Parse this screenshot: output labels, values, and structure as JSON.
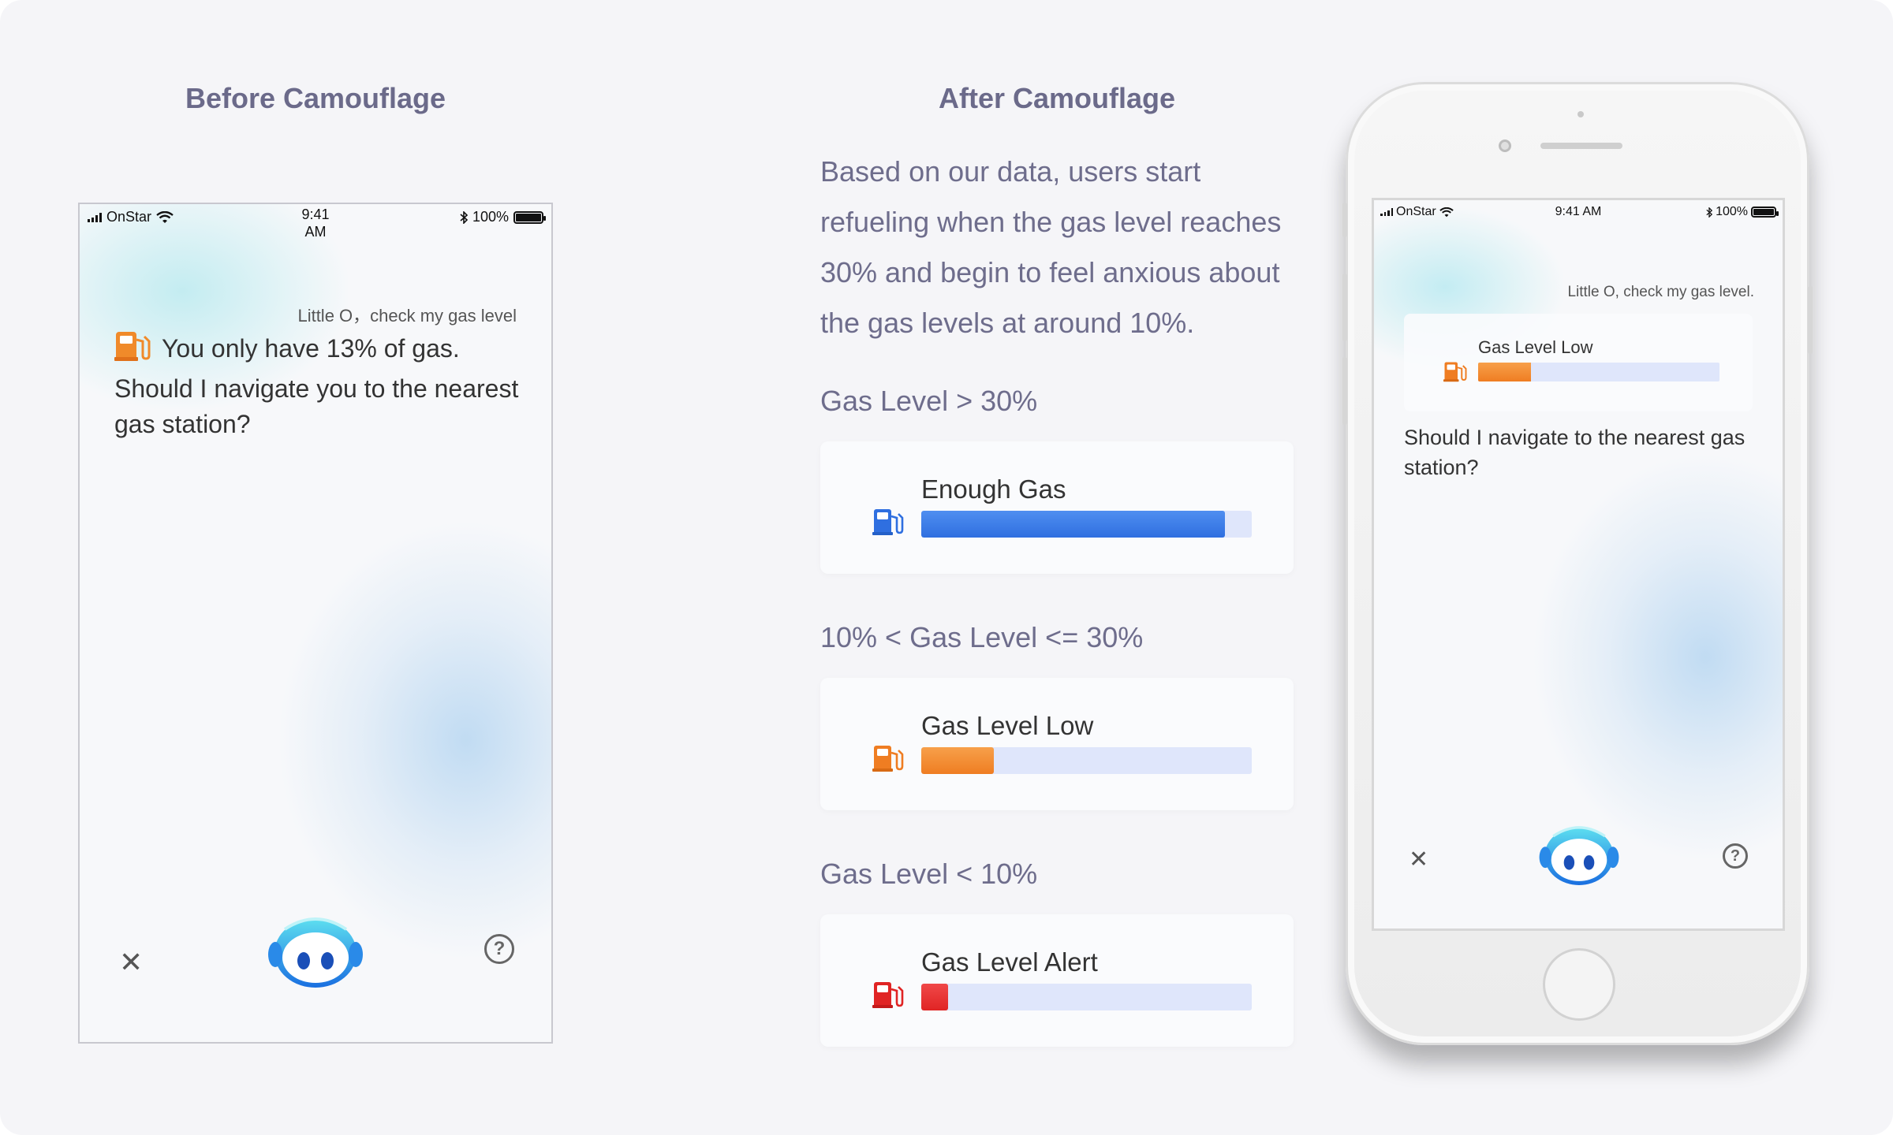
{
  "before": {
    "title": "Before Camouflage",
    "status": {
      "carrier": "OnStar",
      "time_line1": "9:41",
      "time_line2": "AM",
      "battery": "100%"
    },
    "user_query": "Little O，check my gas level",
    "reply": "You only have 13% of gas. Should I navigate you to the nearest gas station?"
  },
  "after": {
    "title": "After Camouflage",
    "explanation": "Based on our data, users start refueling when the gas level reaches 30% and begin to feel anxious about the gas levels at around 10%.",
    "levels": [
      {
        "condition": "Gas Level > 30%",
        "card_title": "Enough Gas",
        "fill": 0.92,
        "color": "#2f6fe0",
        "color_light": "#4f8ef0"
      },
      {
        "condition": "10% < Gas Level <= 30%",
        "card_title": "Gas Level Low",
        "fill": 0.22,
        "color": "#ef7d22",
        "color_light": "#f7a04a"
      },
      {
        "condition": "Gas Level < 10%",
        "card_title": "Gas Level Alert",
        "fill": 0.08,
        "color": "#e02424",
        "color_light": "#f04848"
      }
    ]
  },
  "iphone": {
    "status": {
      "carrier": "OnStar",
      "time": "9:41 AM",
      "battery": "100%"
    },
    "user_query": "Little O, check my gas level.",
    "card_title": "Gas Level Low",
    "fill": 0.22,
    "reply": "Should I navigate to the nearest gas station?"
  },
  "icons": [
    "signal-icon",
    "wifi-icon",
    "bluetooth-icon",
    "battery-icon",
    "gas-pump-icon",
    "close-icon",
    "assistant-robot-icon",
    "help-icon"
  ]
}
